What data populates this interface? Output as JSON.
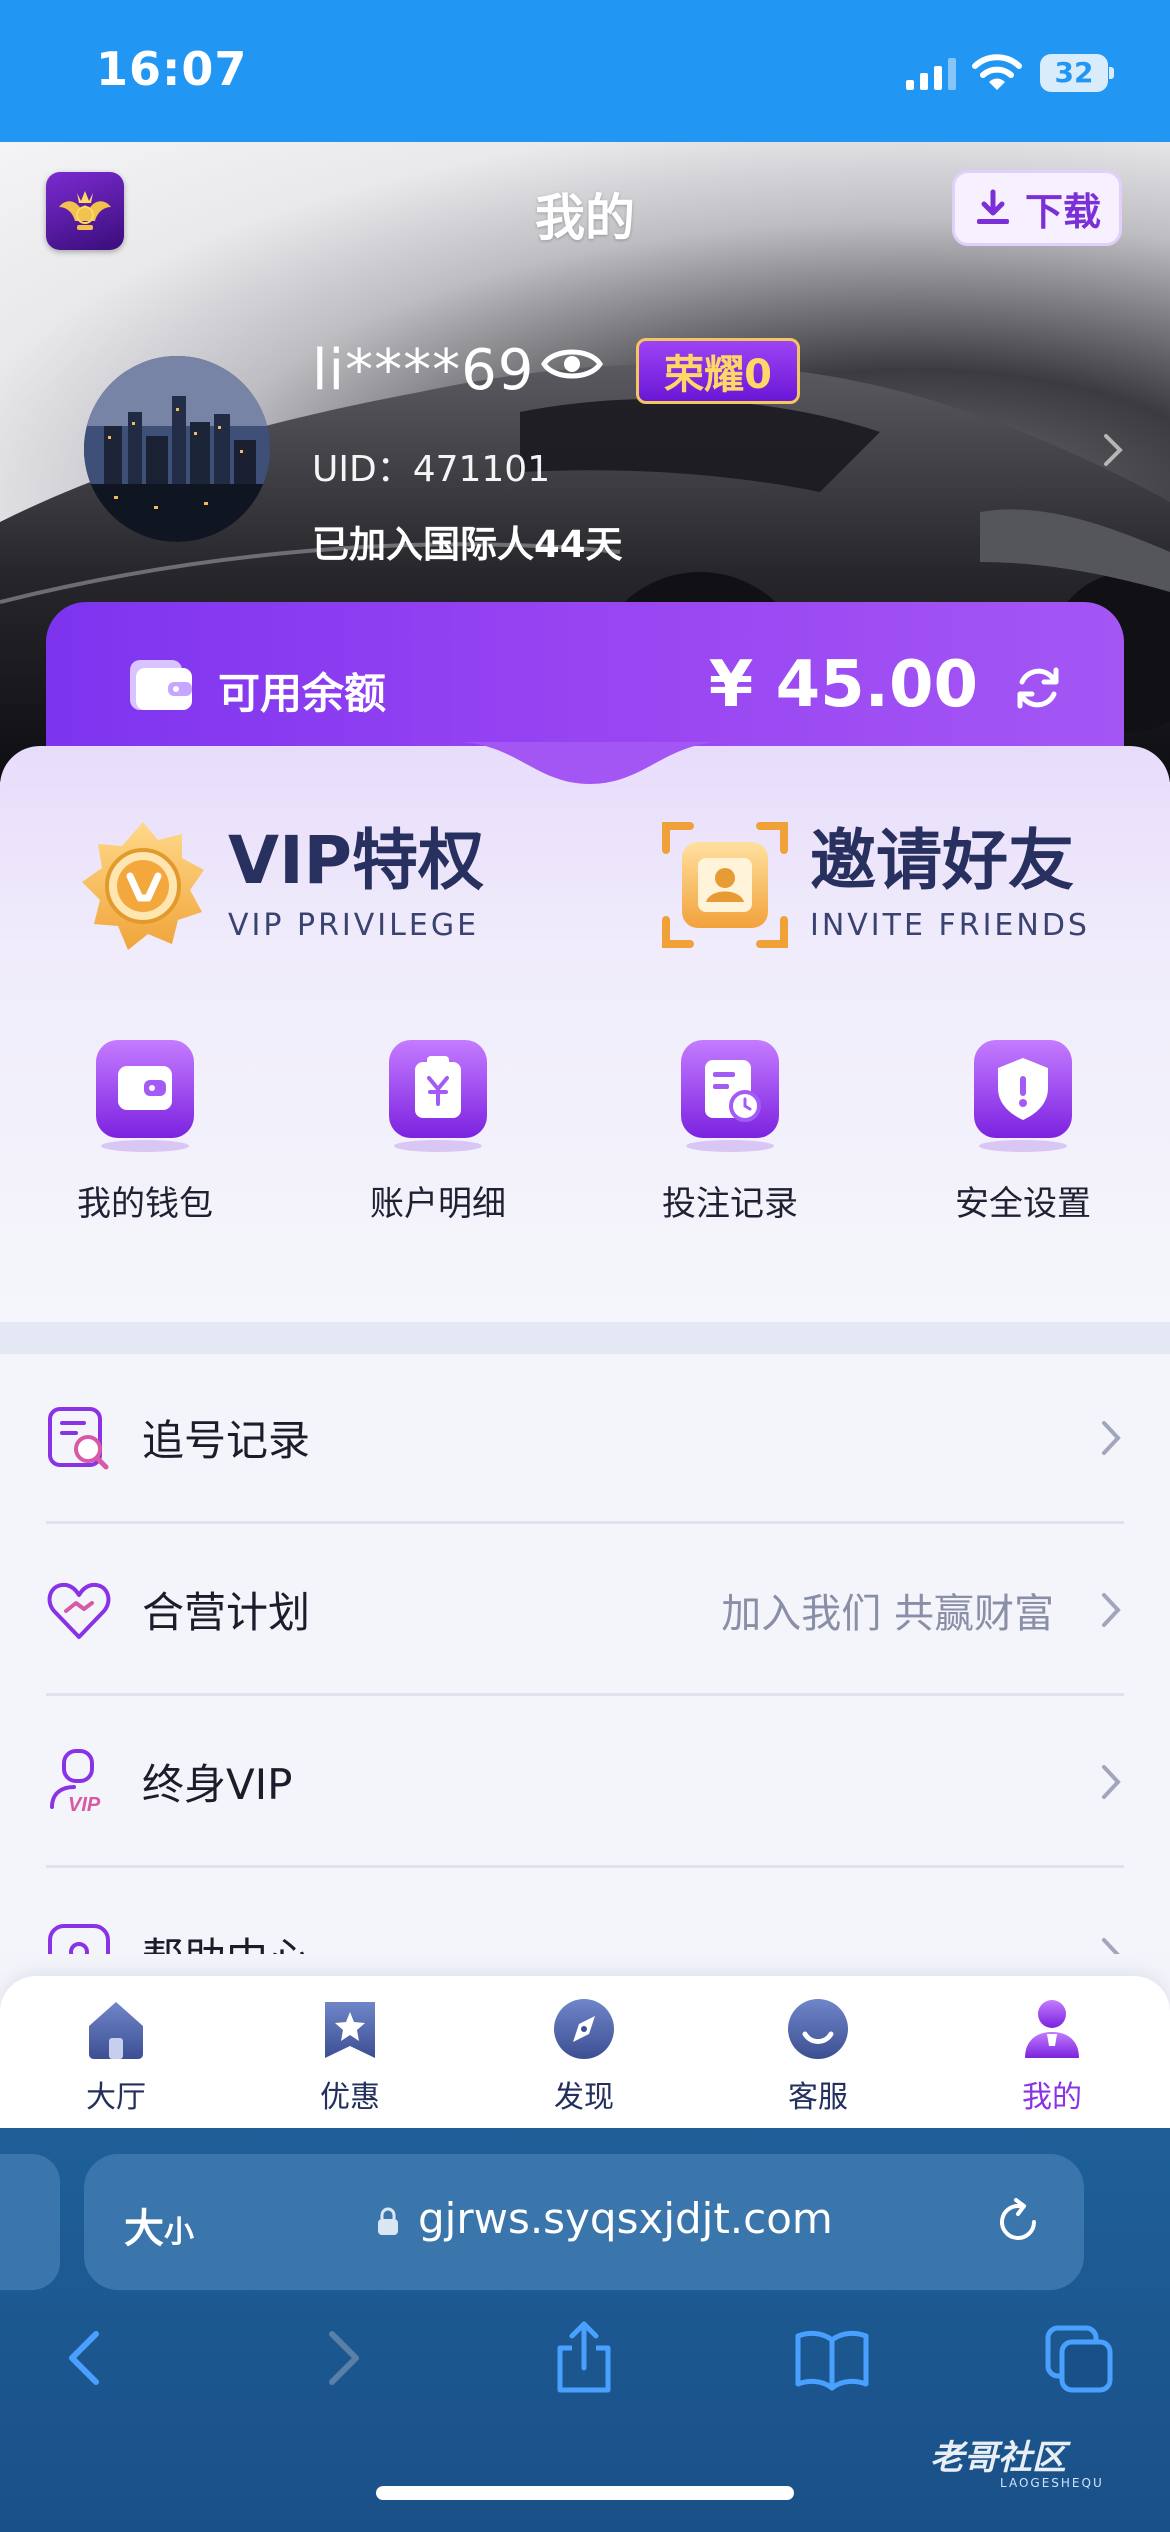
{
  "status_bar": {
    "time": "16:07",
    "battery": "32"
  },
  "header": {
    "title": "我的",
    "download_label": "下载"
  },
  "profile": {
    "username": "li****69",
    "honor_badge": "荣耀0",
    "uid": "UID：471101",
    "joined": "已加入国际人44天"
  },
  "balance": {
    "label": "可用余额",
    "amount": "¥ 45.00"
  },
  "privileges": [
    {
      "title": "VIP特权",
      "subtitle": "VIP PRIVILEGE"
    },
    {
      "title": "邀请好友",
      "subtitle": "INVITE FRIENDS"
    }
  ],
  "quick_actions": [
    {
      "label": "我的钱包",
      "icon": "wallet-icon"
    },
    {
      "label": "账户明细",
      "icon": "yen-receipt-icon"
    },
    {
      "label": "投注记录",
      "icon": "bet-record-icon"
    },
    {
      "label": "安全设置",
      "icon": "shield-icon"
    }
  ],
  "menu": [
    {
      "label": "追号记录",
      "hint": "",
      "icon": "search-record-icon"
    },
    {
      "label": "合营计划",
      "hint": "加入我们 共赢财富",
      "icon": "heart-handshake-icon"
    },
    {
      "label": "终身VIP",
      "hint": "",
      "icon": "vip-user-icon"
    },
    {
      "label": "帮助中心",
      "hint": "",
      "icon": "help-icon"
    }
  ],
  "tabs": [
    {
      "label": "大厅",
      "icon": "home-icon"
    },
    {
      "label": "优惠",
      "icon": "star-bookmark-icon"
    },
    {
      "label": "发现",
      "icon": "compass-icon"
    },
    {
      "label": "客服",
      "icon": "support-icon"
    },
    {
      "label": "我的",
      "icon": "user-icon",
      "active": true
    }
  ],
  "browser": {
    "text_size_label": "大",
    "text_size_small": "小",
    "url": "gjrws.syqsxjdjt.com"
  },
  "watermark": {
    "text": "老哥社区",
    "sub": "LAOGESHEQU"
  },
  "colors": {
    "accent": "#8a33e6",
    "status_bar": "#2196f3",
    "browser": "#1f5f98"
  }
}
